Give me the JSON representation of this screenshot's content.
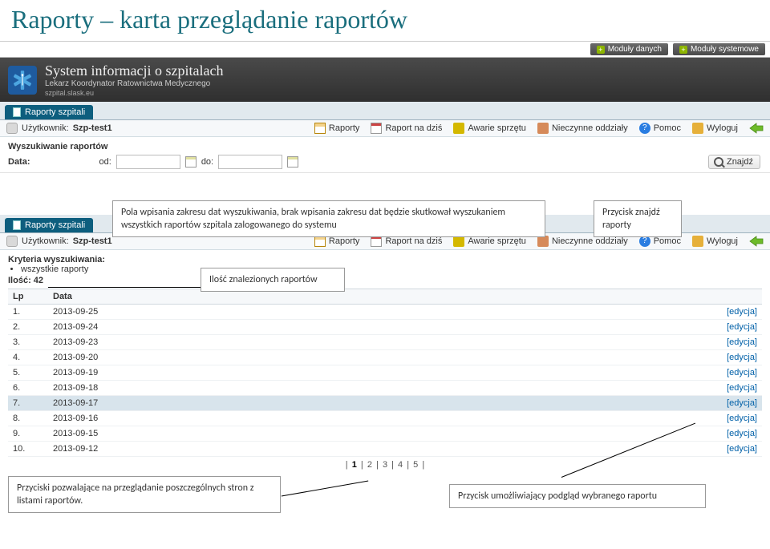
{
  "slide_title": "Raporty – karta przeglądanie raportów",
  "module_buttons": {
    "data": "Moduły danych",
    "system": "Moduły systemowe"
  },
  "banner": {
    "title": "System informacji o szpitalach",
    "subtitle": "Lekarz Koordynator Ratownictwa Medycznego",
    "domain": "szpital.slask.eu"
  },
  "tab": {
    "label": "Raporty szpitali"
  },
  "toolbar": {
    "user_prefix": "Użytkownik:",
    "user_name": "Szp-test1",
    "items": {
      "reports": "Raporty",
      "today": "Raport na dziś",
      "faults": "Awarie sprzętu",
      "closed": "Nieczynne oddziały",
      "help": "Pomoc",
      "logout": "Wyloguj"
    }
  },
  "search": {
    "heading": "Wyszukiwanie raportów",
    "data_label": "Data:",
    "from_label": "od:",
    "to_label": "do:",
    "from_value": "",
    "to_value": "",
    "find_label": "Znajdź"
  },
  "callouts": {
    "range": "Pola wpisania zakresu dat wyszukiwania, brak wpisania zakresu dat będzie skutkował wyszukaniem wszystkich raportów szpitala zalogowanego do systemu",
    "find": "Przycisk znajdź raporty",
    "count": "Ilość znalezionych raportów",
    "pager": "Przyciski pozwalające na przeglądanie poszczególnych stron z listami raportów.",
    "edit": "Przycisk umożliwiający podgląd wybranego raportu"
  },
  "results": {
    "criteria_label": "Kryteria wyszukiwania:",
    "criteria_item": "wszystkie raporty",
    "count_label": "Ilość:",
    "count_value": "42",
    "col_lp": "Lp",
    "col_date": "Data",
    "edit_label": "[edycja]",
    "rows": [
      {
        "lp": "1.",
        "date": "2013-09-25"
      },
      {
        "lp": "2.",
        "date": "2013-09-24"
      },
      {
        "lp": "3.",
        "date": "2013-09-23"
      },
      {
        "lp": "4.",
        "date": "2013-09-20"
      },
      {
        "lp": "5.",
        "date": "2013-09-19"
      },
      {
        "lp": "6.",
        "date": "2013-09-18"
      },
      {
        "lp": "7.",
        "date": "2013-09-17"
      },
      {
        "lp": "8.",
        "date": "2013-09-16"
      },
      {
        "lp": "9.",
        "date": "2013-09-15"
      },
      {
        "lp": "10.",
        "date": "2013-09-12"
      }
    ],
    "pager": [
      "1",
      "2",
      "3",
      "4",
      "5"
    ]
  }
}
